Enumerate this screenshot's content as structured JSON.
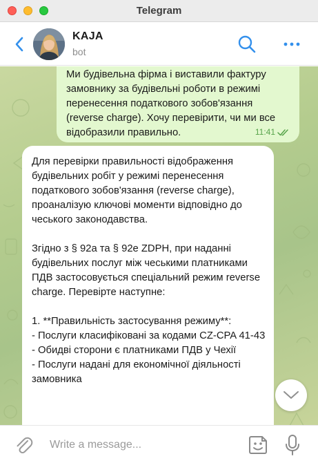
{
  "window": {
    "title": "Telegram"
  },
  "header": {
    "contact_name": "KAJA",
    "contact_status": "bot"
  },
  "messages": [
    {
      "direction": "outgoing",
      "text": "Ми будівельна фірма і виставили фактуру замовнику за будівельні роботи в режимі перенесення податкового зобов'язання (reverse charge). Хочу перевірити, чи ми все відобразили правильно.",
      "time": "11:41",
      "status": "read"
    },
    {
      "direction": "incoming",
      "text": "Для перевірки правильності відображення будівельних робіт у режимі перенесення податкового зобов'язання (reverse charge), проаналізую ключові моменти відповідно до чеського законодавства.\n\nЗгідно з § 92a та § 92e ZDPH, при наданні будівельних послуг між чеськими платниками ПДВ застосовується спеціальний режим reverse charge. Перевірте наступне:\n\n1. **Правильність застосування режиму**:\n   - Послуги класифіковані за кодами CZ-CPA 41-43\n   - Обидві сторони є платниками ПДВ у Чехії\n   - Послуги надані для економічної діяльності замовника"
    }
  ],
  "composer": {
    "placeholder": "Write a message..."
  },
  "colors": {
    "outgoing_bubble": "#e3f8cf",
    "incoming_bubble": "#ffffff",
    "accent": "#3390ec",
    "read_check": "#56a34a"
  },
  "icons": [
    "back-icon",
    "search-icon",
    "more-icon",
    "chevron-down-icon",
    "paperclip-icon",
    "sticker-icon",
    "microphone-icon",
    "double-check-icon"
  ]
}
